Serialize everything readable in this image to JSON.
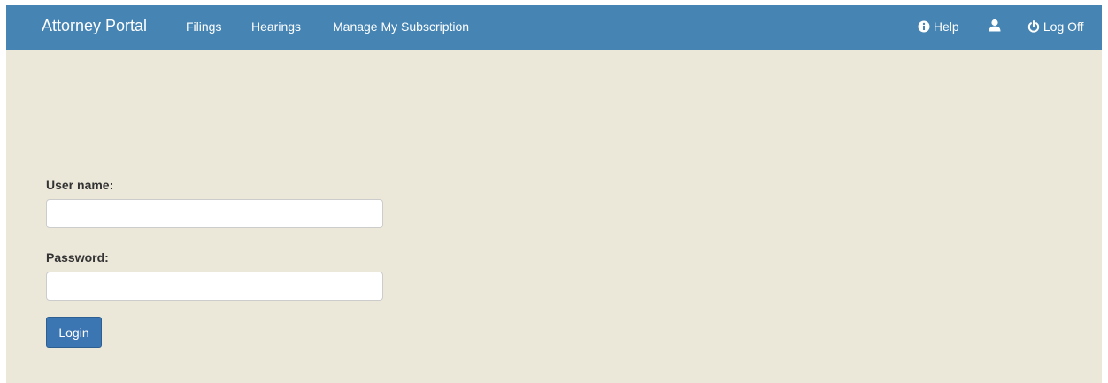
{
  "navbar": {
    "brand": "Attorney Portal",
    "links": [
      {
        "label": "Filings"
      },
      {
        "label": "Hearings"
      },
      {
        "label": "Manage My Subscription"
      }
    ],
    "help_label": "Help",
    "help_icon": "info-circle-icon",
    "user_icon": "user-icon",
    "logoff_label": "Log Off",
    "logoff_icon": "power-icon",
    "background": "#4584b3"
  },
  "login_form": {
    "username_label": "User name:",
    "username_value": "",
    "password_label": "Password:",
    "password_value": "",
    "submit_label": "Login",
    "button_color": "#3c76b2"
  },
  "page": {
    "background": "#ebe7d9"
  }
}
